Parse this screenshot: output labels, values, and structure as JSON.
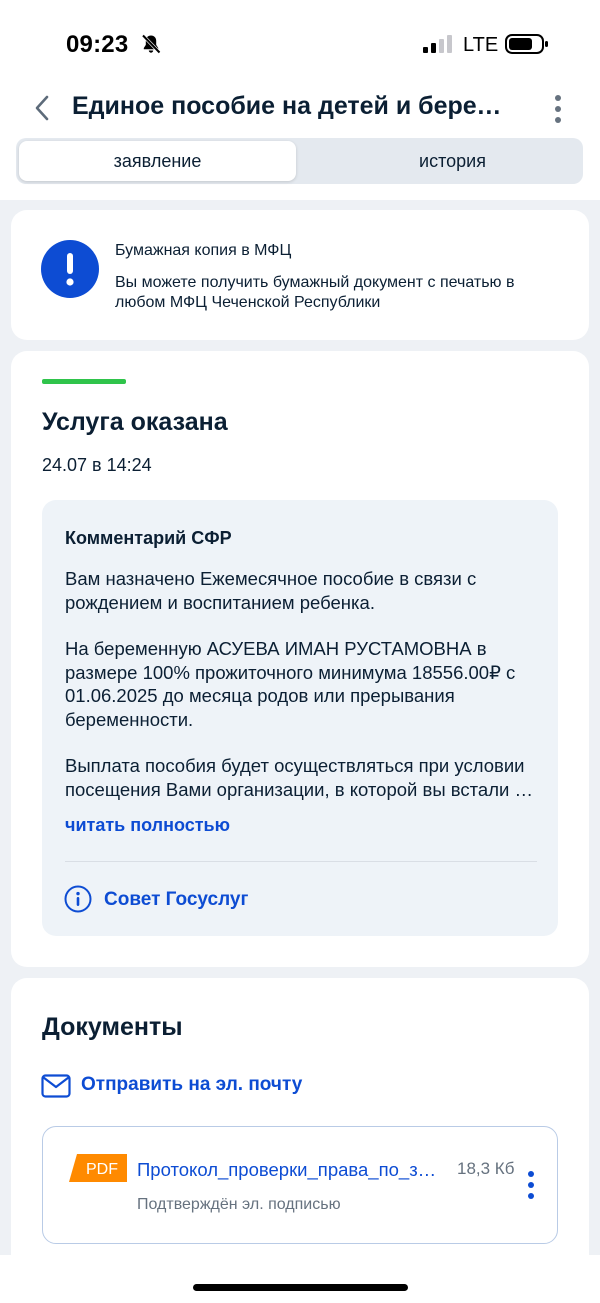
{
  "status_bar": {
    "time": "09:23",
    "network": "LTE"
  },
  "header": {
    "title": "Единое пособие на детей и беременных"
  },
  "tabs": [
    {
      "label": "заявление",
      "active": true
    },
    {
      "label": "история",
      "active": false
    }
  ],
  "mfc_notice": {
    "title": "Бумажная копия в МФЦ",
    "text": "Вы можете получить бумажный документ с печатью в любом МФЦ Чеченской Республики"
  },
  "status_card": {
    "title": "Услуга оказана",
    "date": "24.07 в 14:24",
    "status_color": "#2fc44b",
    "comment": {
      "title": "Комментарий СФР",
      "paragraphs": [
        "Вам назначено Ежемесячное пособие в связи с рождением и воспитанием ребенка.",
        "На беременную АСУЕВА ИМАН РУСТАМОВНА в размере 100% прожиточного минимума 18556.00₽ с 01.06.2025 до месяца родов или прерывания беременности.",
        "Выплата пособия будет осуществляться при условии посещения Вами организации, в которой вы встали на учет"
      ],
      "read_more": "читать полностью",
      "advice_link": "Совет Госуслуг"
    }
  },
  "documents": {
    "title": "Документы",
    "send_email": "Отправить на эл. почту",
    "files": [
      {
        "badge": "PDF",
        "name": "Протокол_проверки_права_по_заявлению.pdf",
        "size": "18,3 Кб",
        "status": "Подтверждён эл. подписью"
      }
    ]
  },
  "colors": {
    "accent": "#0d4cd3",
    "alert": "#0d4cd3",
    "pdf_badge": "#ff8a00",
    "background": "#eef1f5"
  }
}
